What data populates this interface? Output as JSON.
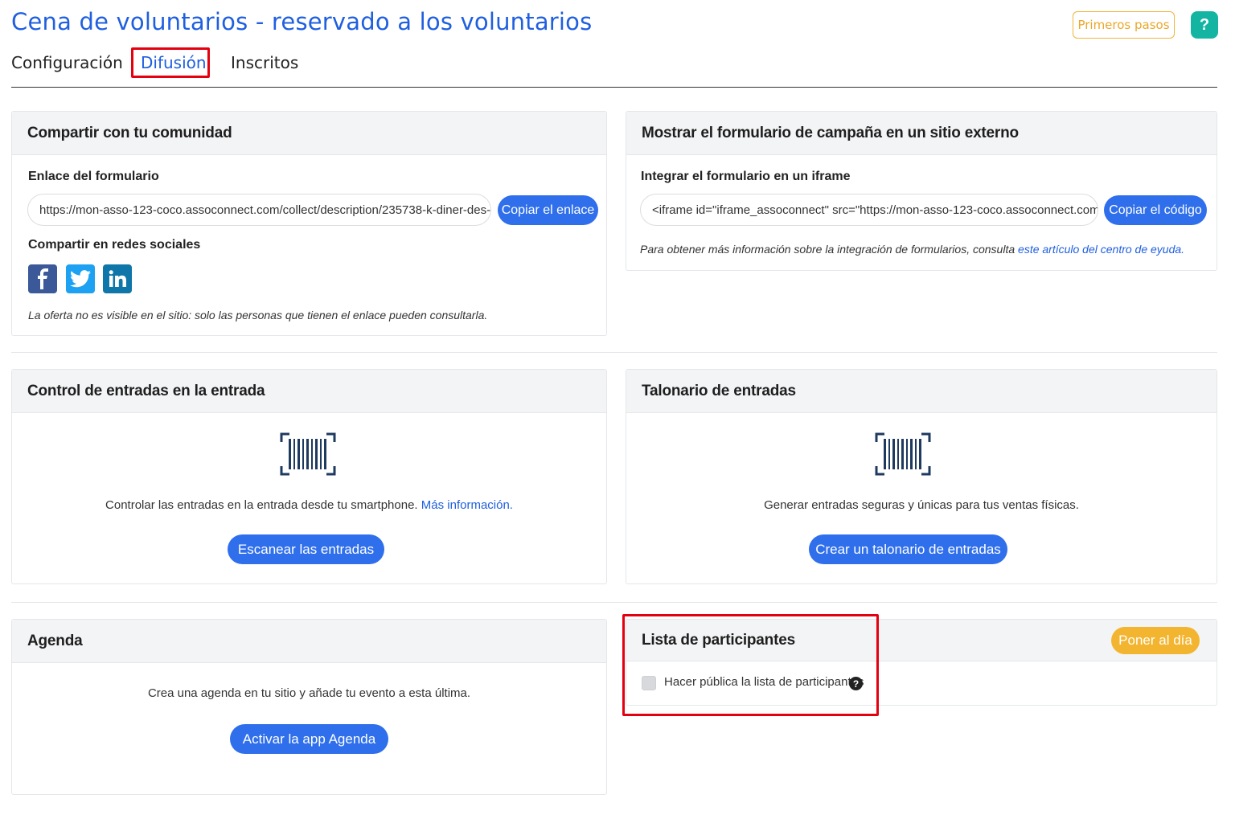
{
  "header": {
    "title": "Cena de voluntarios - reservado a los voluntarios",
    "first_steps": "Primeros pasos",
    "help": "?"
  },
  "tabs": [
    {
      "label": "Configuración",
      "active": false
    },
    {
      "label": "Difusión",
      "active": true
    },
    {
      "label": "Inscritos",
      "active": false
    }
  ],
  "share": {
    "title": "Compartir con tu comunidad",
    "link_label": "Enlace del formulario",
    "link_value": "https://mon-asso-123-coco.assoconnect.com/collect/description/235738-k-diner-des-",
    "copy_button": "Copiar el enlace",
    "social_label": "Compartir en redes sociales",
    "social_icons": [
      "facebook-icon",
      "twitter-icon",
      "linkedin-icon"
    ],
    "note": "La oferta no es visible en el sitio: solo las personas que tienen el enlace pueden consultarla."
  },
  "embed": {
    "title": "Mostrar el formulario de campaña en un sitio externo",
    "iframe_label": "Integrar el formulario en un iframe",
    "iframe_value": "<iframe id=\"iframe_assoconnect\" src=\"https://mon-asso-123-coco.assoconnect.com,",
    "copy_button": "Copiar el código",
    "note_prefix": "Para obtener más información sobre la integración de formularios, consulta ",
    "note_link": "este artículo del centro de eyuda."
  },
  "control": {
    "title": "Control de entradas en la entrada",
    "text": "Controlar las entradas en la entrada desde tu smartphone. ",
    "link": "Más información.",
    "button": "Escanear las entradas"
  },
  "booklet": {
    "title": "Talonario de entradas",
    "text": "Generar entradas seguras y únicas para tus ventas físicas.",
    "button": "Crear un talonario de entradas"
  },
  "agenda": {
    "title": "Agenda",
    "text": "Crea una agenda en tu sitio y añade tu evento a esta última.",
    "button": "Activar la app Agenda"
  },
  "participants": {
    "title": "Lista de participantes",
    "update_button": "Poner al día",
    "checkbox_label": "Hacer pública la lista de participantes",
    "checked": false
  },
  "colors": {
    "primary": "#2f6fec",
    "title_blue": "#1f5fe0",
    "warning": "#f3b52f",
    "help": "#13b5a2",
    "highlight": "#e3000f",
    "facebook": "#3b5998",
    "twitter": "#1da1f2",
    "linkedin": "#0e76a8"
  }
}
